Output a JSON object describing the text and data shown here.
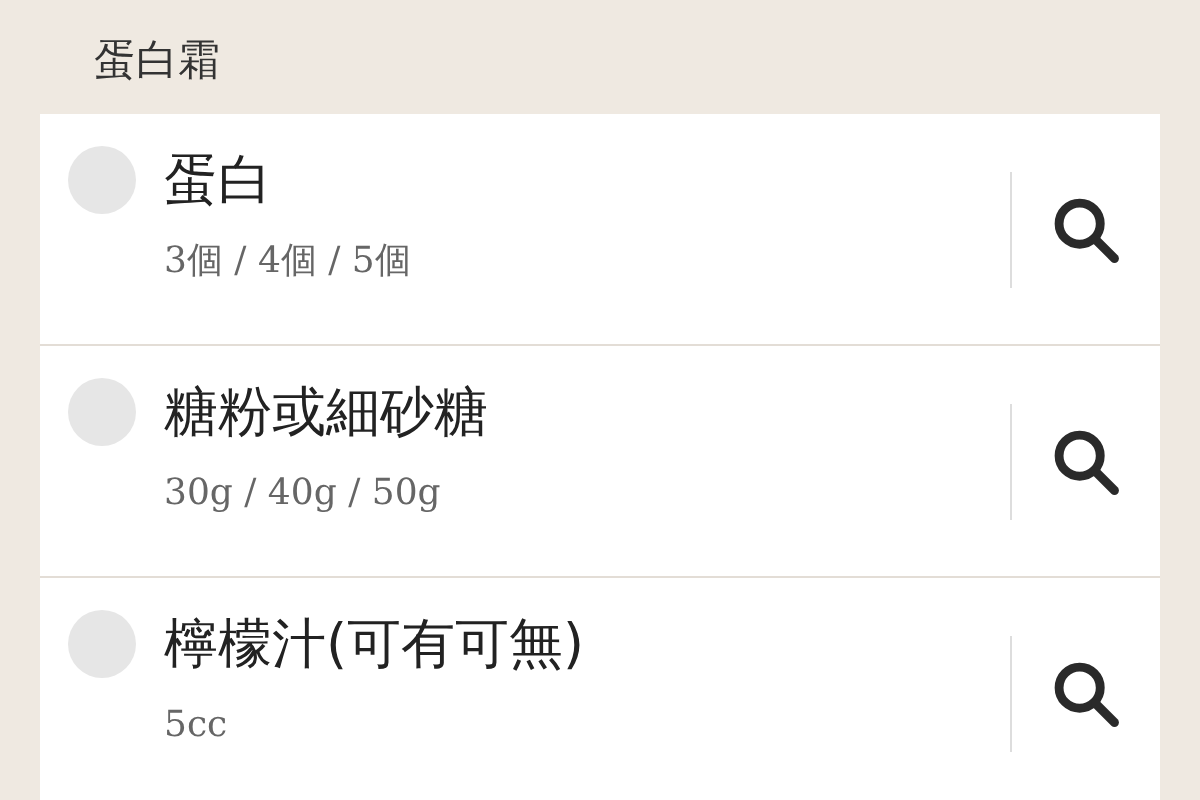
{
  "section": {
    "title": "蛋白霜"
  },
  "items": [
    {
      "name": "蛋白",
      "amounts": "3個 / 4個 / 5個",
      "checked": false
    },
    {
      "name": "糖粉或細砂糖",
      "amounts": "30g / 40g / 50g",
      "checked": false
    },
    {
      "name": "檸檬汁(可有可無)",
      "amounts": "5cc",
      "checked": false
    }
  ]
}
